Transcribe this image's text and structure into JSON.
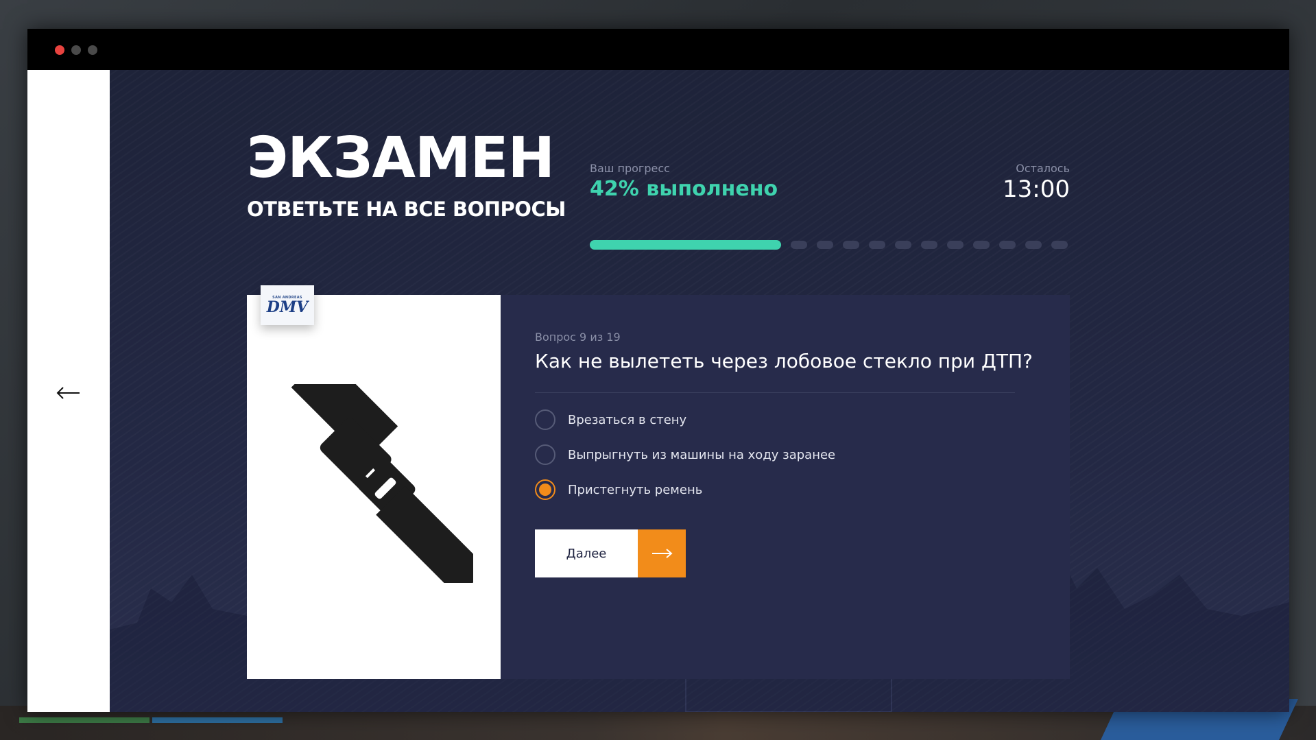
{
  "window": {
    "titlebar_dots": [
      "close",
      "minimize",
      "maximize"
    ],
    "accent_color": "#3fd3ae",
    "highlight_color": "#f28c1a"
  },
  "sidebar": {
    "back_icon": "arrow-left-icon"
  },
  "header": {
    "title": "ЭКЗАМЕН",
    "subtitle": "ОТВЕТЬТЕ НА ВСЕ ВОПРОСЫ"
  },
  "progress": {
    "label": "Ваш прогресс",
    "value_text": "42% выполнено",
    "percent": 42,
    "remaining_segments": 11
  },
  "timer": {
    "label": "Осталось",
    "value": "13:00"
  },
  "question": {
    "badge_top": "SAN ANDREAS",
    "badge_text": "DMV",
    "image_icon": "seatbelt-icon",
    "counter": "Вопрос 9 из 19",
    "text": "Как не вылететь через лобовое стекло при ДТП?",
    "answers": [
      {
        "label": "Врезаться в стену",
        "selected": false
      },
      {
        "label": "Выпрыгнуть из машины на ходу заранее",
        "selected": false
      },
      {
        "label": "Пристегнуть ремень",
        "selected": true
      }
    ]
  },
  "actions": {
    "next_label": "Далее",
    "next_icon": "arrow-right-icon"
  }
}
